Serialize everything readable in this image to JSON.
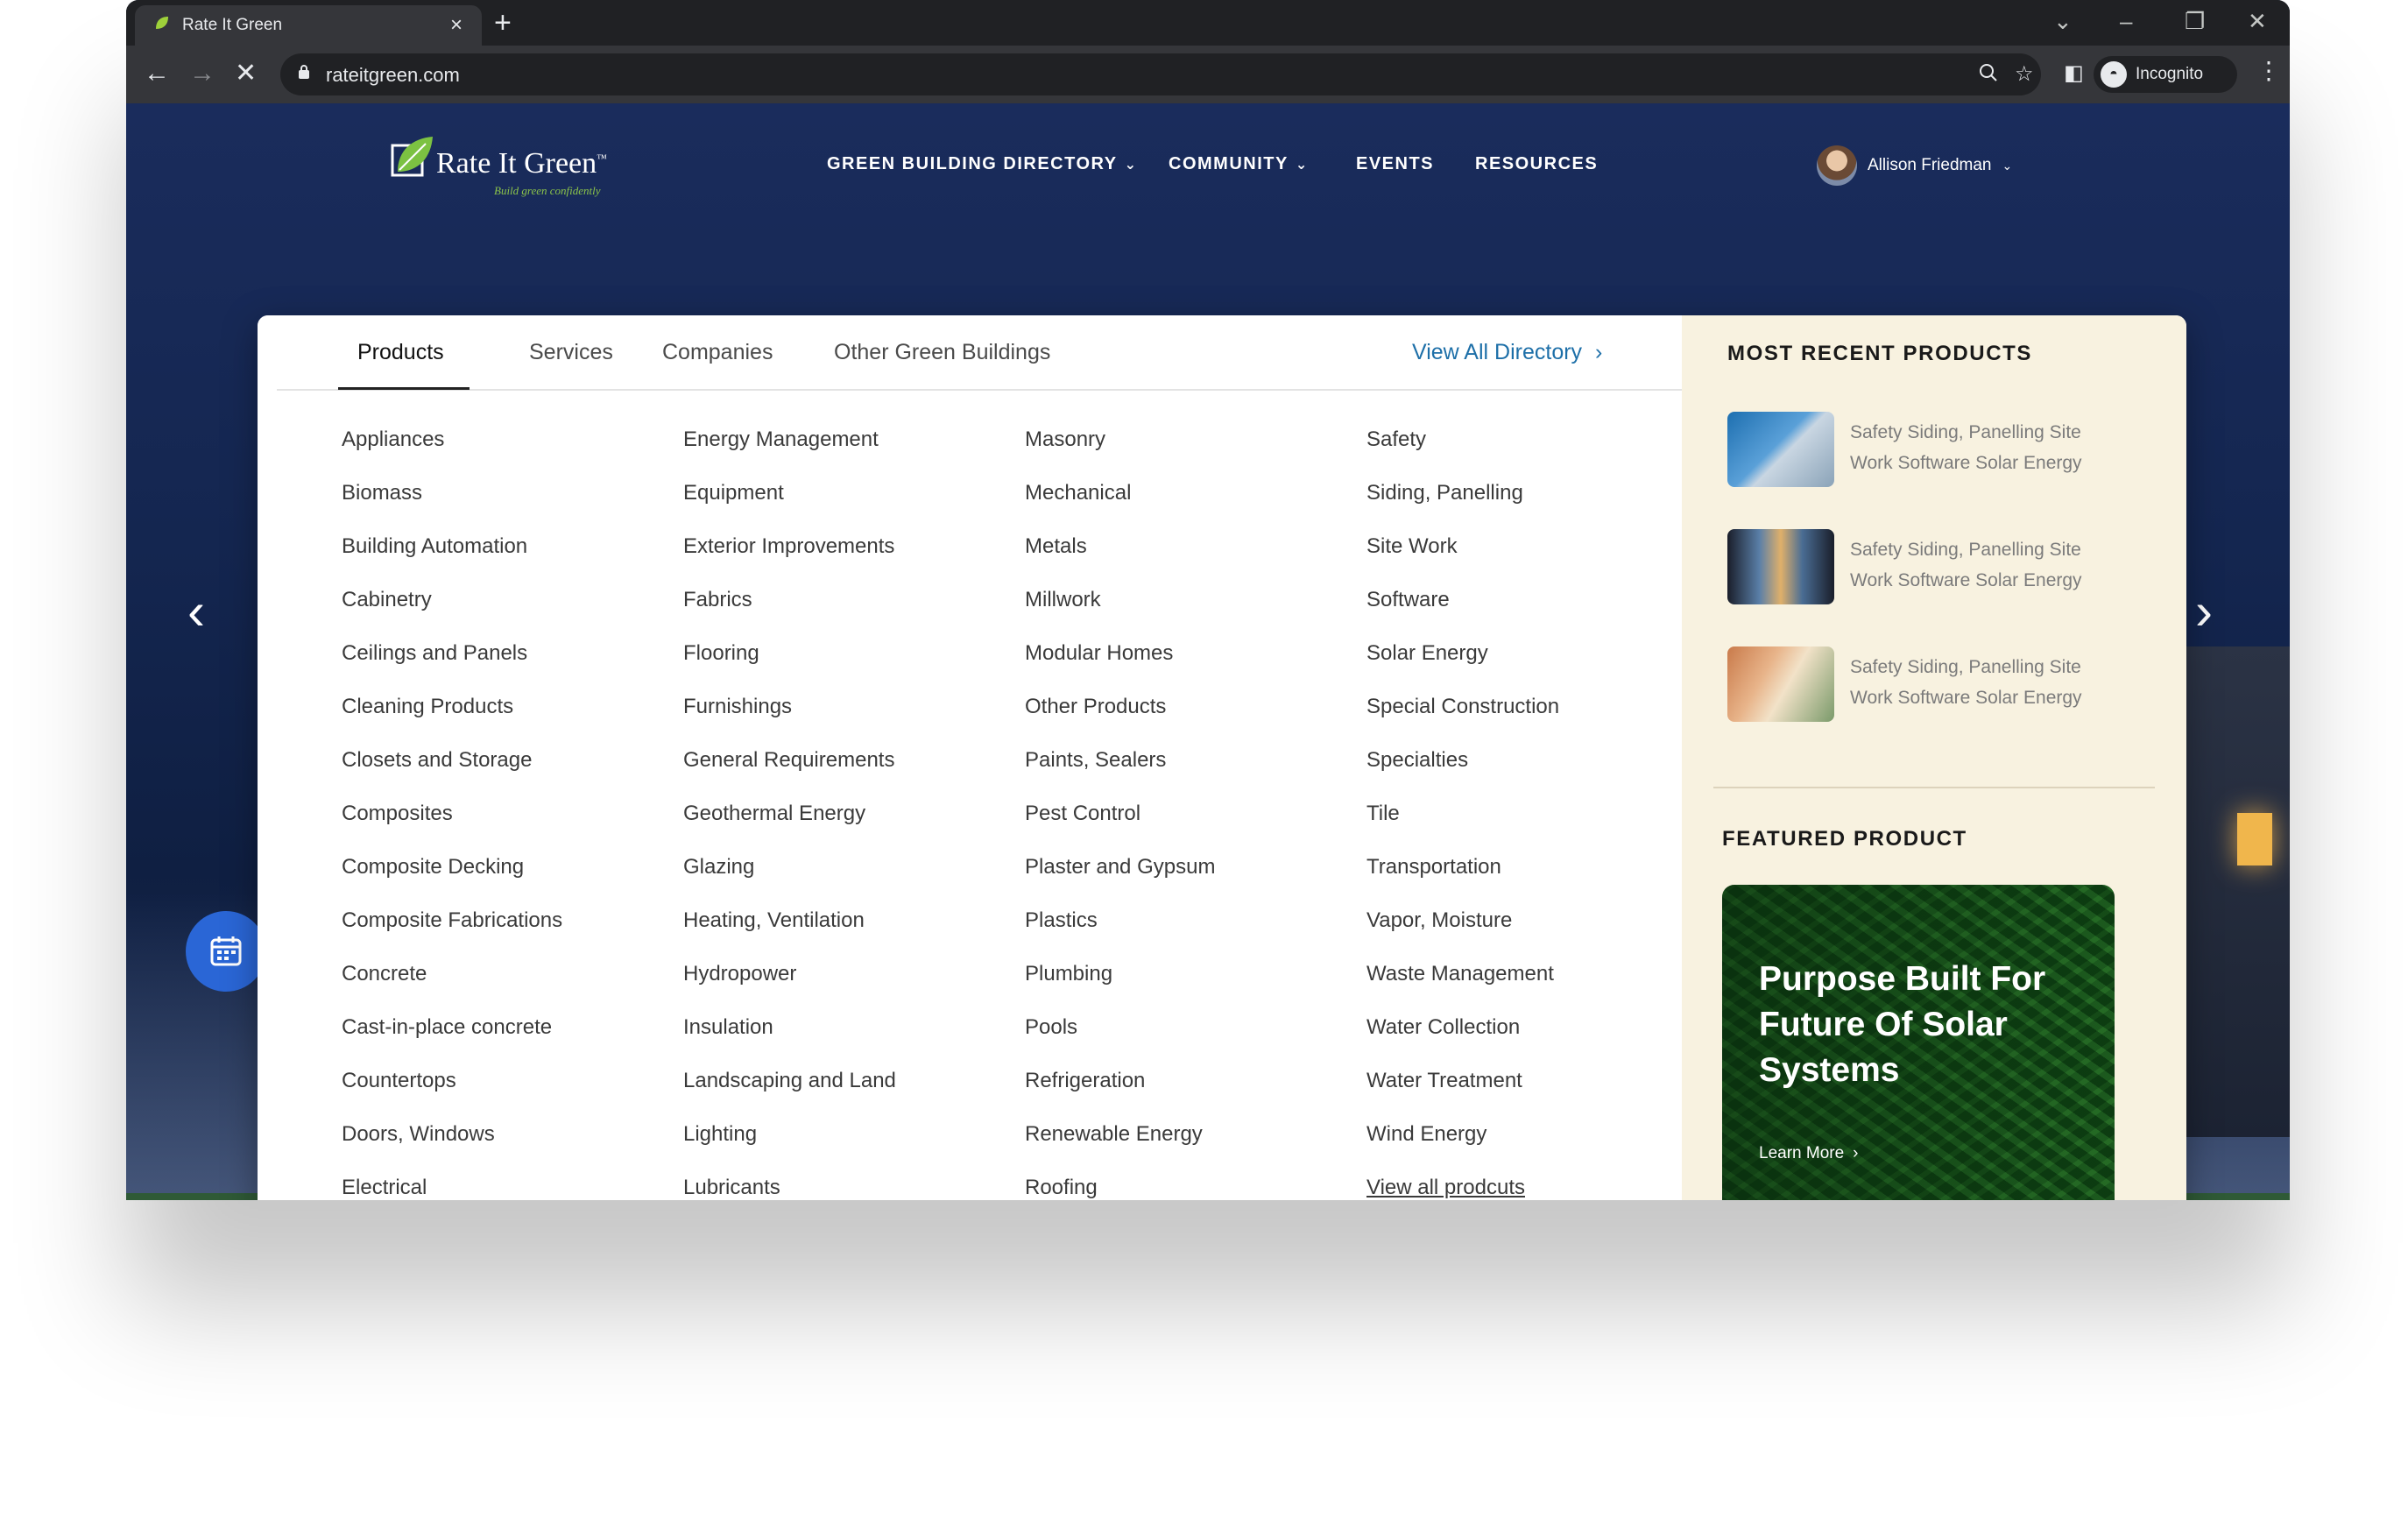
{
  "browser": {
    "tab_title": "Rate It Green",
    "new_tab_label": "+",
    "url": "rateitgreen.com",
    "profile_label": "Incognito",
    "window_controls": [
      "⌄",
      "–",
      "❐",
      "✕"
    ],
    "toolbar_icons": [
      "zoom-icon",
      "star-icon",
      "sidepanel-icon",
      "incognito-icon",
      "menu-icon"
    ]
  },
  "site": {
    "logo_name": "Rate It Green",
    "logo_trademark": "™",
    "logo_tagline": "Build green confidently",
    "nav": [
      {
        "label": "GREEN BUILDING DIRECTORY",
        "chevron": "⌄"
      },
      {
        "label": "COMMUNITY",
        "chevron": "⌄"
      },
      {
        "label": "EVENTS",
        "chevron": ""
      },
      {
        "label": "RESOURCES",
        "chevron": ""
      }
    ],
    "user_name": "Allison Friedman"
  },
  "mega_menu": {
    "tabs": [
      "Products",
      "Services",
      "Companies",
      "Other Green Buildings"
    ],
    "active_tab": "Products",
    "view_all_directory": "View All Directory",
    "columns": [
      [
        "Appliances",
        "Biomass",
        "Building Automation",
        "Cabinetry",
        "Ceilings and Panels",
        "Cleaning Products",
        "Closets and Storage",
        "Composites",
        "Composite Decking",
        "Composite Fabrications",
        "Concrete",
        "Cast-in-place concrete",
        "Countertops",
        "Doors, Windows",
        "Electrical"
      ],
      [
        "Energy Management",
        "Equipment",
        "Exterior Improvements",
        "Fabrics",
        "Flooring",
        "Furnishings",
        "General Requirements",
        "Geothermal Energy",
        "Glazing",
        "Heating, Ventilation",
        "Hydropower",
        "Insulation",
        "Landscaping and Land",
        "Lighting",
        "Lubricants"
      ],
      [
        "Masonry",
        "Mechanical",
        "Metals",
        "Millwork",
        "Modular Homes",
        "Other Products",
        "Paints, Sealers",
        "Pest Control",
        "Plaster and Gypsum",
        "Plastics",
        "Plumbing",
        "Pools",
        "Refrigeration",
        "Renewable Energy",
        "Roofing"
      ],
      [
        "Safety",
        "Siding, Panelling",
        "Site Work",
        "Software",
        "Solar Energy",
        "Special Construction",
        "Specialties",
        "Tile",
        "Transportation",
        "Vapor, Moisture",
        "Waste Management",
        "Water Collection",
        "Water Treatment",
        "Wind Energy",
        "View all prodcuts"
      ]
    ],
    "recent_title": "MOST RECENT PRODUCTS",
    "recent_products": [
      {
        "line1": "Safety Siding, Panelling Site",
        "line2": "Work Software Solar Energy"
      },
      {
        "line1": "Safety Siding, Panelling Site",
        "line2": "Work Software Solar Energy"
      },
      {
        "line1": "Safety Siding, Panelling Site",
        "line2": "Work Software Solar Energy"
      }
    ],
    "featured_title": "FEATURED PRODUCT",
    "featured_heading": "Purpose Built For Future Of Solar Systems",
    "featured_link": "Learn More"
  },
  "colors": {
    "accent_blue": "#1d6fa8",
    "brand_green": "#8bc34a",
    "panel_cream": "#f8f2e0",
    "card_green": "#1f5b22"
  }
}
